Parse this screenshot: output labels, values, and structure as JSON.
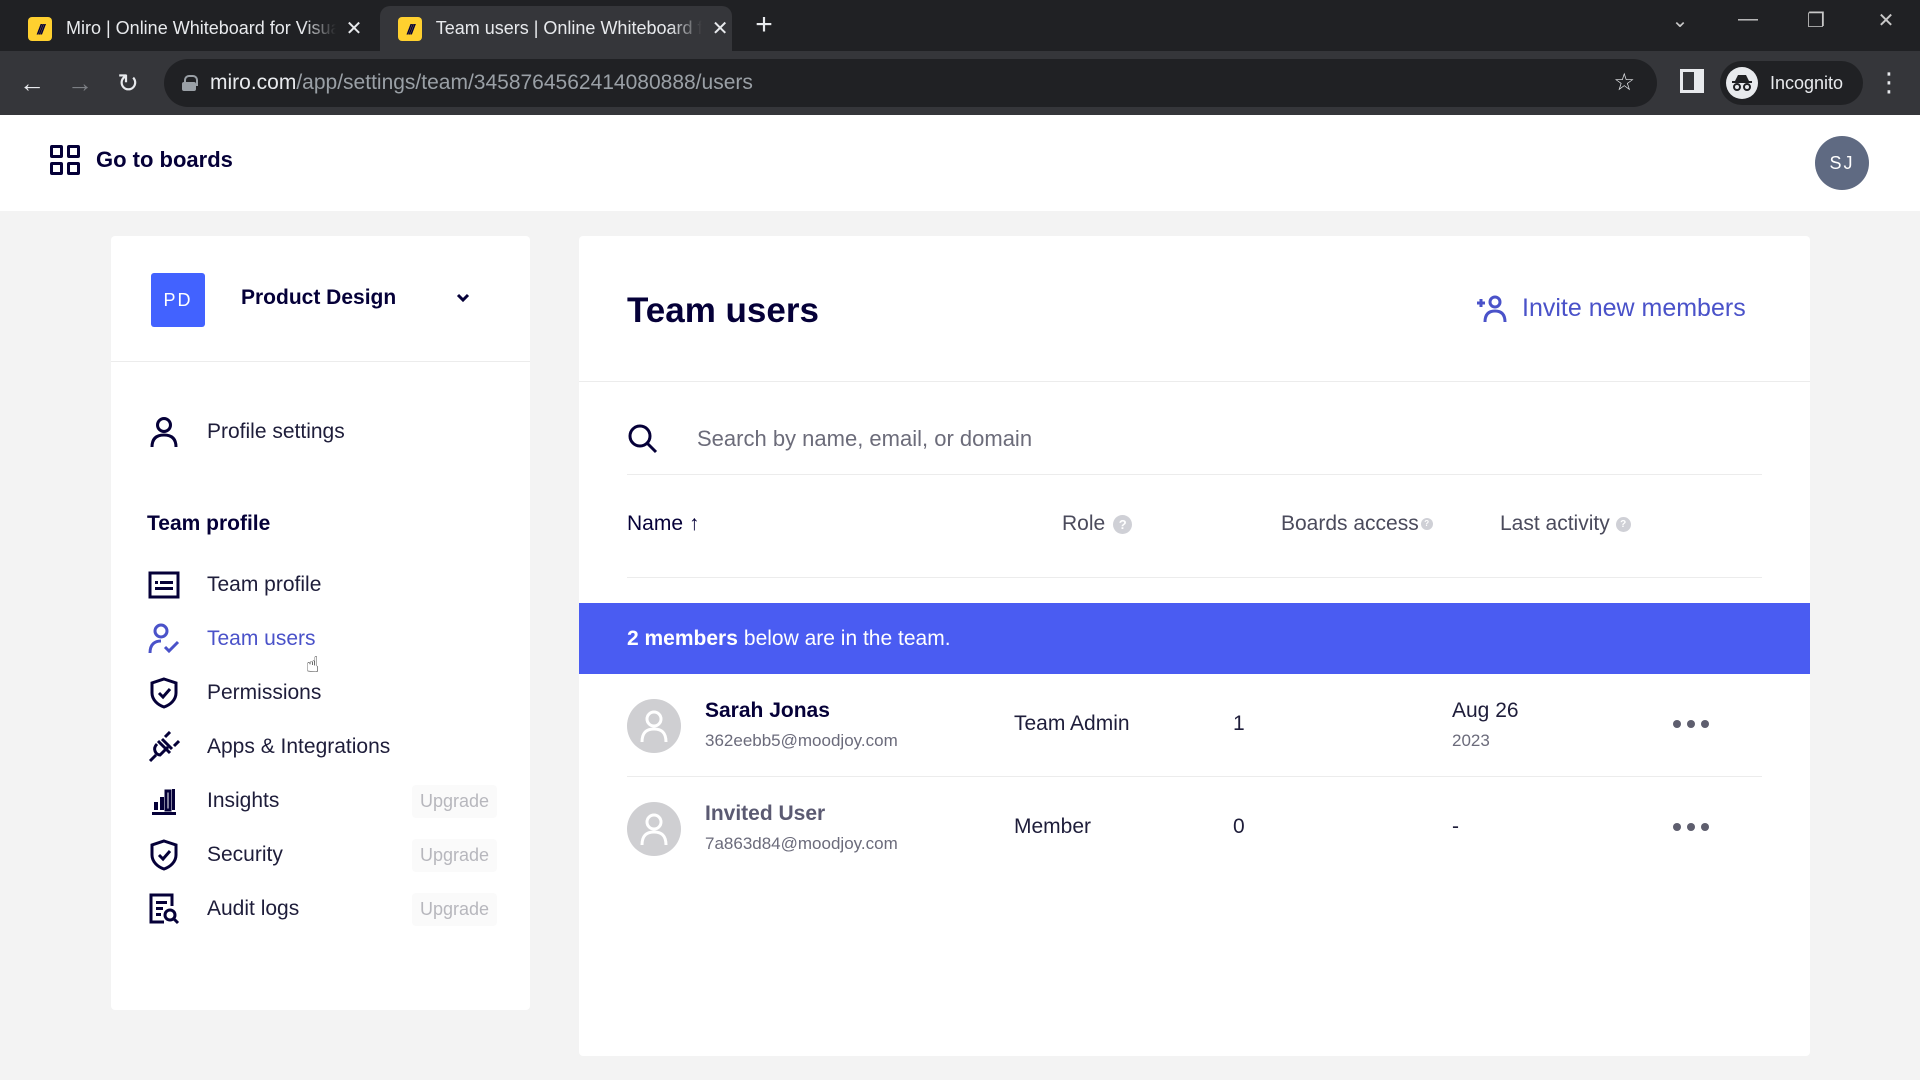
{
  "browser": {
    "tabs": [
      {
        "title": "Miro | Online Whiteboard for Visual Collaboration",
        "favicon": "miro-logo",
        "active": false
      },
      {
        "title": "Team users | Online Whiteboard for Visual Collaboration",
        "favicon": "miro-logo",
        "active": true
      }
    ],
    "new_tab_label": "+",
    "url_host": "miro.com",
    "url_path": "/app/settings/team/3458764562414080888/users",
    "profile_label": "Incognito"
  },
  "header": {
    "go_to_boards": "Go to boards",
    "user_initials": "SJ"
  },
  "team": {
    "initials": "PD",
    "name": "Product Design",
    "badge_color": "#4262ff"
  },
  "sidebar": {
    "profile_settings": "Profile settings",
    "section_title": "Team profile",
    "items": [
      {
        "label": "Team profile",
        "icon": "id-card-icon",
        "upgrade": null,
        "active": false
      },
      {
        "label": "Team users",
        "icon": "user-check-icon",
        "upgrade": null,
        "active": true
      },
      {
        "label": "Permissions",
        "icon": "shield-check-icon",
        "upgrade": null,
        "active": false
      },
      {
        "label": "Apps & Integrations",
        "icon": "plug-icon",
        "upgrade": null,
        "active": false
      },
      {
        "label": "Insights",
        "icon": "bar-chart-icon",
        "upgrade": "Upgrade",
        "active": false
      },
      {
        "label": "Security",
        "icon": "shield-check-icon",
        "upgrade": "Upgrade",
        "active": false
      },
      {
        "label": "Audit logs",
        "icon": "document-search-icon",
        "upgrade": "Upgrade",
        "active": false
      }
    ]
  },
  "main": {
    "title": "Team users",
    "invite_label": "Invite new members",
    "search_placeholder": "Search by name, email, or domain",
    "search_value": "",
    "columns": {
      "name": "Name",
      "name_sort": "↑",
      "role": "Role",
      "boards_access": "Boards access",
      "last_activity": "Last activity",
      "help_glyph": "?"
    },
    "banner": {
      "count_text": "2 members",
      "rest_text": "below are in the team.",
      "color": "#4a5cf2"
    },
    "members": [
      {
        "name": "Sarah Jonas",
        "email": "362eebb5@moodjoy.com",
        "role": "Team Admin",
        "boards": "1",
        "last_activity_date": "Aug 26",
        "last_activity_year": "2023"
      },
      {
        "name": "Invited User",
        "email": "7a863d84@moodjoy.com",
        "role": "Member",
        "boards": "0",
        "last_activity": "-"
      }
    ]
  },
  "accent_color": "#4a52c9"
}
